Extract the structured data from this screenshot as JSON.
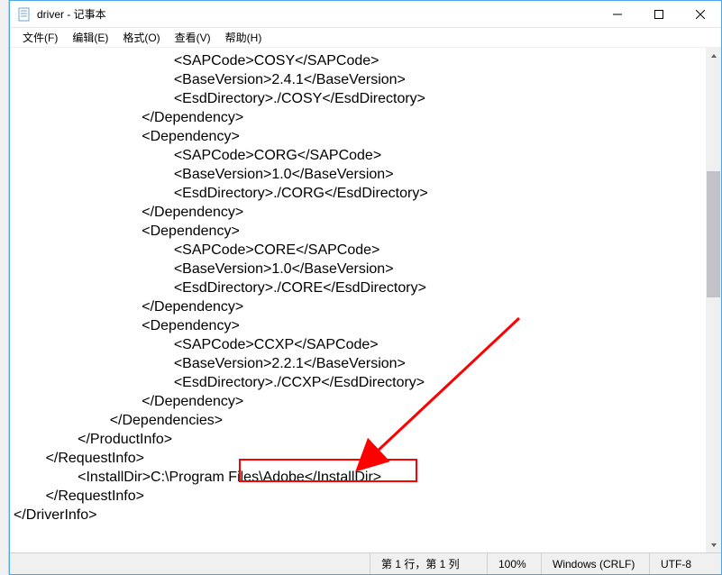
{
  "window": {
    "title": "driver - 记事本"
  },
  "menu": {
    "file": "文件(F)",
    "edit": "编辑(E)",
    "format": "格式(O)",
    "view": "查看(V)",
    "help": "帮助(H)"
  },
  "content": {
    "lines": [
      "                                        <SAPCode>COSY</SAPCode>",
      "                                        <BaseVersion>2.4.1</BaseVersion>",
      "                                        <EsdDirectory>./COSY</EsdDirectory>",
      "                                </Dependency>",
      "                                <Dependency>",
      "                                        <SAPCode>CORG</SAPCode>",
      "                                        <BaseVersion>1.0</BaseVersion>",
      "                                        <EsdDirectory>./CORG</EsdDirectory>",
      "                                </Dependency>",
      "                                <Dependency>",
      "                                        <SAPCode>CORE</SAPCode>",
      "                                        <BaseVersion>1.0</BaseVersion>",
      "                                        <EsdDirectory>./CORE</EsdDirectory>",
      "                                </Dependency>",
      "                                <Dependency>",
      "                                        <SAPCode>CCXP</SAPCode>",
      "                                        <BaseVersion>2.2.1</BaseVersion>",
      "                                        <EsdDirectory>./CCXP</EsdDirectory>",
      "                                </Dependency>",
      "                        </Dependencies>",
      "                </ProductInfo>",
      "        </RequestInfo>",
      "                <InstallDir>C:\\Program Files\\Adobe</InstallDir>",
      "        </RequestInfo>",
      "</DriverInfo>"
    ]
  },
  "status": {
    "pos": "第 1 行，第 1 列",
    "zoom": "100%",
    "lineend": "Windows (CRLF)",
    "encoding": "UTF-8"
  },
  "annotation": {
    "highlight_text": "C:\\Program Files\\Adobe"
  }
}
